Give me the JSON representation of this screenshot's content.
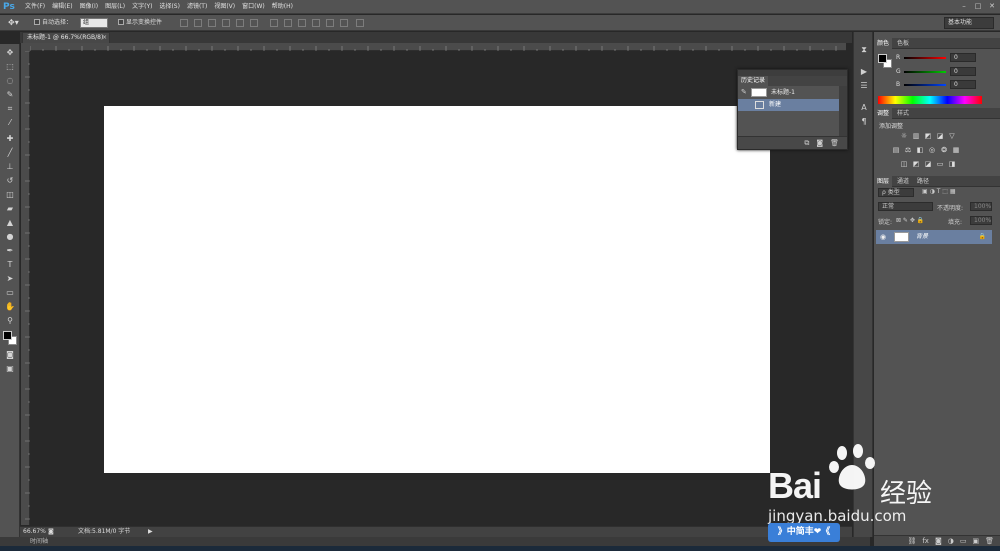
{
  "app": {
    "logo": "Ps",
    "menus": [
      "文件(F)",
      "编辑(E)",
      "图像(I)",
      "图层(L)",
      "文字(Y)",
      "选择(S)",
      "滤镜(T)",
      "视图(V)",
      "窗口(W)",
      "帮助(H)"
    ],
    "window_controls": [
      "–",
      "□",
      "✕"
    ]
  },
  "options_bar": {
    "auto_select_label": "自动选择：",
    "auto_select_value": "组",
    "show_transform_label": "显示变换控件",
    "workspace": "基本功能"
  },
  "document": {
    "tab_title": "未标题-1 @ 66.7%(RGB/8)",
    "tab_close": "×"
  },
  "status_bar": {
    "zoom": "66.67%",
    "doc_info": "文档:5.81M/0 字节",
    "timeline_label": "时间轴"
  },
  "color_panel": {
    "tabs": [
      "颜色",
      "色板"
    ],
    "sliders": [
      {
        "label": "R",
        "value": "0",
        "color": "#ff3030"
      },
      {
        "label": "G",
        "value": "0",
        "color": "#30c030"
      },
      {
        "label": "B",
        "value": "0",
        "color": "#3060ff"
      }
    ]
  },
  "adjust_panel": {
    "tabs": [
      "调整",
      "样式"
    ],
    "title": "添加调整"
  },
  "layers_panel": {
    "tabs": [
      "图层",
      "通道",
      "路径"
    ],
    "filter_kind": "ρ 类型",
    "blend_mode": "正常",
    "opacity_label": "不透明度:",
    "opacity_value": "100%",
    "lock_label": "锁定:",
    "fill_label": "填充:",
    "fill_value": "100%",
    "layers": [
      {
        "name": "背景"
      }
    ]
  },
  "history_panel": {
    "tab": "历史记录",
    "snapshot_name": "未标题-1",
    "states": [
      "新建"
    ]
  },
  "watermark": {
    "logo_text": "Bai",
    "logo_text2": "经验",
    "url": "jingyan.baidu.com",
    "badge": "》中简丰❤《"
  },
  "colors": {
    "ui_dark": "#282828",
    "panel": "#535353",
    "selection": "#6a7fa0",
    "accent_blue": "#49a8e8"
  }
}
